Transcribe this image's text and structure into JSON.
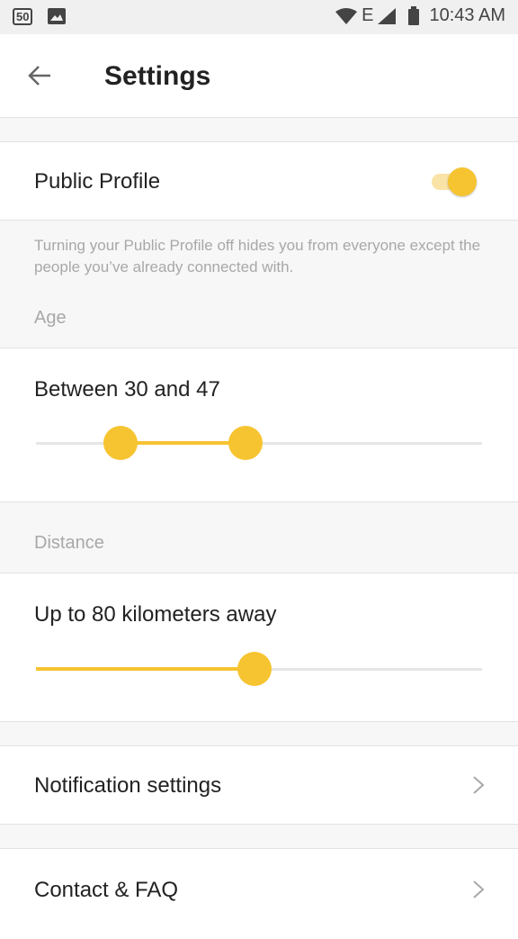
{
  "status_bar": {
    "badge": "50",
    "network": "E",
    "time": "10:43 AM"
  },
  "header": {
    "title": "Settings"
  },
  "public_profile": {
    "label": "Public Profile",
    "enabled": true,
    "hint": "Turning your Public Profile off hides you from everyone except the people you’ve already connected with."
  },
  "age": {
    "section_label": "Age",
    "value_text": "Between 30 and 47",
    "range_fraction": [
      0.19,
      0.47
    ]
  },
  "distance": {
    "section_label": "Distance",
    "value_text": "Up to 80 kilometers away",
    "value_fraction": 0.49
  },
  "links": {
    "notifications": "Notification settings",
    "contact": "Contact & FAQ"
  },
  "colors": {
    "accent": "#f6c431",
    "accent_light": "#f9e3a7"
  }
}
